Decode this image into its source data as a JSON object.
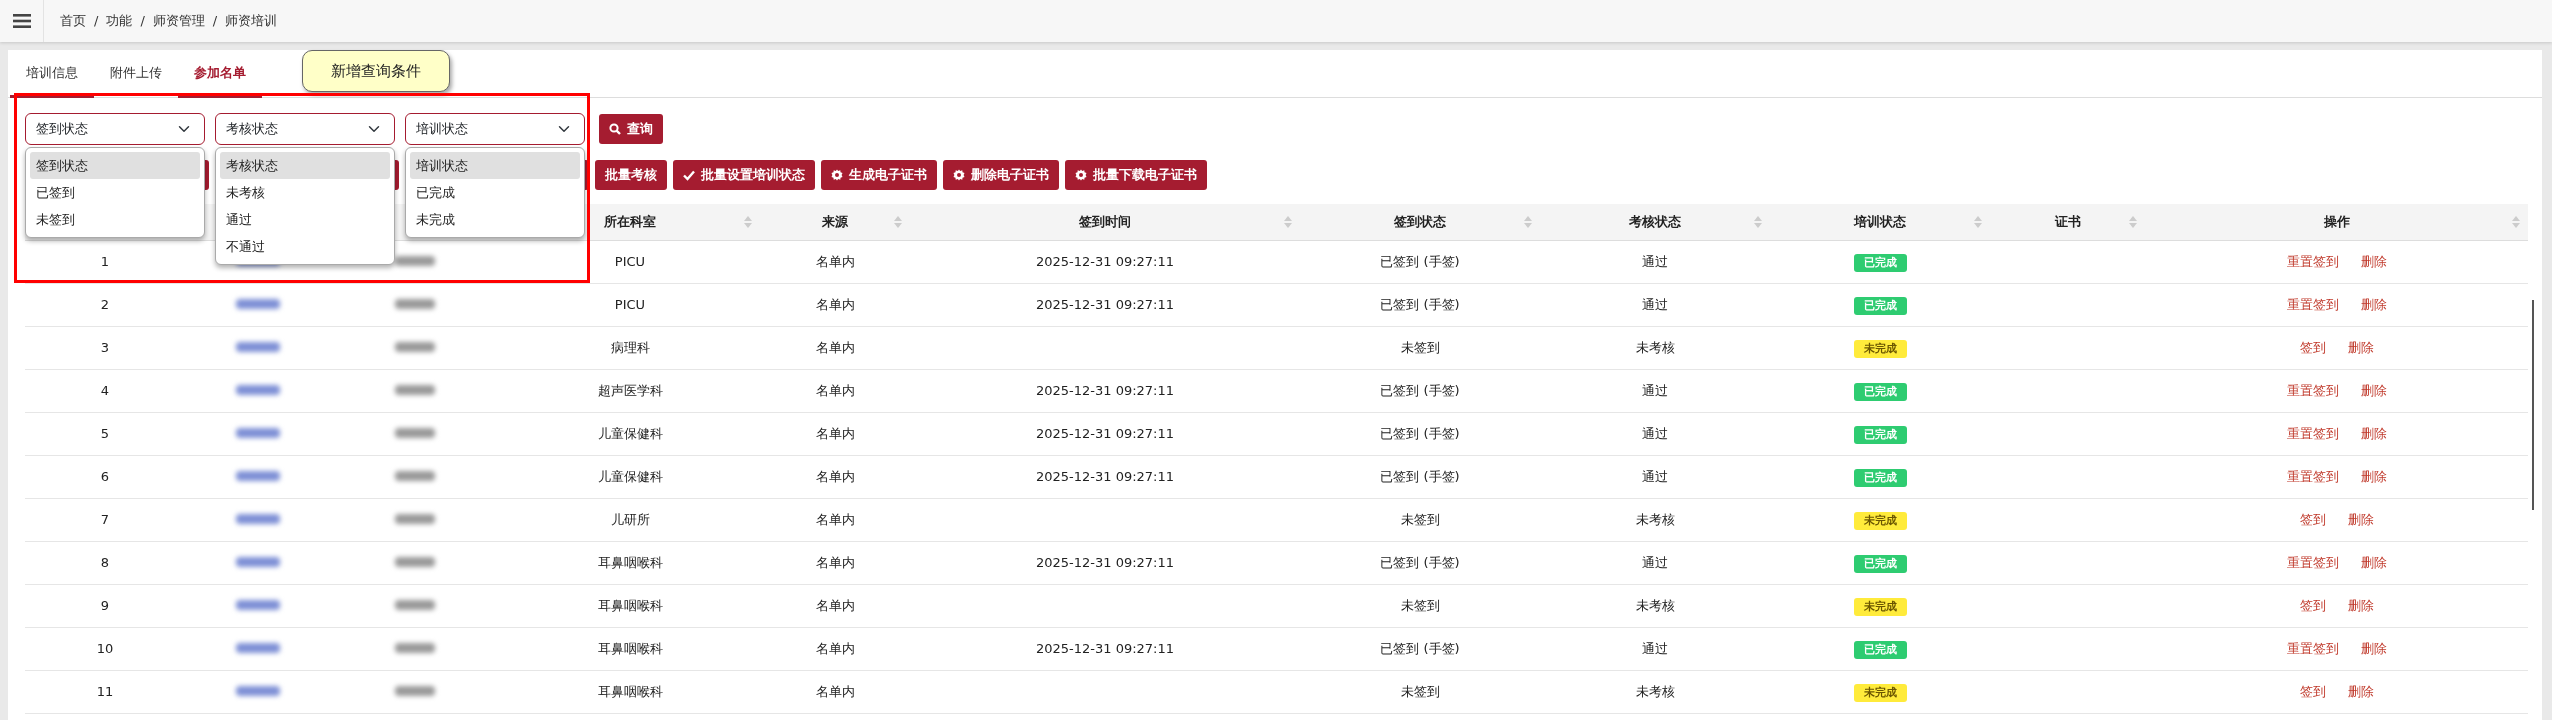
{
  "breadcrumb": [
    {
      "kind": "item",
      "text": "首页"
    },
    {
      "kind": "separator",
      "text": "/"
    },
    {
      "kind": "item",
      "text": "功能"
    },
    {
      "kind": "separator",
      "text": "/"
    },
    {
      "kind": "item",
      "text": "师资管理"
    },
    {
      "kind": "separator",
      "text": "/"
    },
    {
      "kind": "item",
      "text": "师资培训"
    }
  ],
  "tabs": [
    {
      "label": "培训信息",
      "selected": false,
      "underlined": true
    },
    {
      "label": "附件上传",
      "selected": false,
      "underlined": false
    },
    {
      "label": "参加名单",
      "selected": true,
      "underlined": true
    }
  ],
  "callout": "新增查询条件",
  "filters": [
    {
      "value": "签到状态",
      "options": [
        {
          "label": "签到状态",
          "selected": true
        },
        {
          "label": "已签到",
          "selected": false
        },
        {
          "label": "未签到",
          "selected": false
        }
      ]
    },
    {
      "value": "考核状态",
      "options": [
        {
          "label": "考核状态",
          "selected": true
        },
        {
          "label": "未考核",
          "selected": false
        },
        {
          "label": "通过",
          "selected": false
        },
        {
          "label": "不通过",
          "selected": false
        }
      ]
    },
    {
      "value": "培训状态",
      "options": [
        {
          "label": "培训状态",
          "selected": true
        },
        {
          "label": "已完成",
          "selected": false
        },
        {
          "label": "未完成",
          "selected": false
        }
      ]
    }
  ],
  "query_button": "查询",
  "toolbar": [
    {
      "kind": "covered"
    },
    {
      "kind": "covered"
    },
    {
      "kind": "covered"
    },
    {
      "kind": "plain",
      "label": "批量考核"
    },
    {
      "kind": "check",
      "label": "批量设置培训状态"
    },
    {
      "kind": "gear",
      "label": "生成电子证书"
    },
    {
      "kind": "gear",
      "label": "删除电子证书"
    },
    {
      "kind": "gear",
      "label": "批量下载电子证书"
    }
  ],
  "table": {
    "columns": [
      "",
      "",
      "",
      "所在科室",
      "来源",
      "签到时间",
      "签到状态",
      "考核状态",
      "培训状态",
      "证书",
      "操作"
    ],
    "rows": [
      {
        "index": "1",
        "department": "PICU",
        "source": "名单内",
        "time": "2025-12-31 09:27:11",
        "signin": "已签到 (手签)",
        "exam": "通过",
        "training": {
          "text": "已完成",
          "kind": "done"
        },
        "actions": [
          "重置签到",
          "删除"
        ]
      },
      {
        "index": "2",
        "department": "PICU",
        "source": "名单内",
        "time": "2025-12-31 09:27:11",
        "signin": "已签到 (手签)",
        "exam": "通过",
        "training": {
          "text": "已完成",
          "kind": "done"
        },
        "actions": [
          "重置签到",
          "删除"
        ]
      },
      {
        "index": "3",
        "department": "病理科",
        "source": "名单内",
        "signin": "未签到",
        "exam": "未考核",
        "training": {
          "text": "未完成",
          "kind": "todo"
        },
        "actions": [
          "签到",
          "删除"
        ]
      },
      {
        "index": "4",
        "department": "超声医学科",
        "source": "名单内",
        "time": "2025-12-31 09:27:11",
        "signin": "已签到 (手签)",
        "exam": "通过",
        "training": {
          "text": "已完成",
          "kind": "done"
        },
        "actions": [
          "重置签到",
          "删除"
        ]
      },
      {
        "index": "5",
        "department": "儿童保健科",
        "source": "名单内",
        "time": "2025-12-31 09:27:11",
        "signin": "已签到 (手签)",
        "exam": "通过",
        "training": {
          "text": "已完成",
          "kind": "done"
        },
        "actions": [
          "重置签到",
          "删除"
        ]
      },
      {
        "index": "6",
        "department": "儿童保健科",
        "source": "名单内",
        "time": "2025-12-31 09:27:11",
        "signin": "已签到 (手签)",
        "exam": "通过",
        "training": {
          "text": "已完成",
          "kind": "done"
        },
        "actions": [
          "重置签到",
          "删除"
        ]
      },
      {
        "index": "7",
        "department": "儿研所",
        "source": "名单内",
        "signin": "未签到",
        "exam": "未考核",
        "training": {
          "text": "未完成",
          "kind": "todo"
        },
        "actions": [
          "签到",
          "删除"
        ]
      },
      {
        "index": "8",
        "department": "耳鼻咽喉科",
        "source": "名单内",
        "time": "2025-12-31 09:27:11",
        "signin": "已签到 (手签)",
        "exam": "通过",
        "training": {
          "text": "已完成",
          "kind": "done"
        },
        "actions": [
          "重置签到",
          "删除"
        ]
      },
      {
        "index": "9",
        "department": "耳鼻咽喉科",
        "source": "名单内",
        "signin": "未签到",
        "exam": "未考核",
        "training": {
          "text": "未完成",
          "kind": "todo"
        },
        "actions": [
          "签到",
          "删除"
        ]
      },
      {
        "index": "10",
        "department": "耳鼻咽喉科",
        "source": "名单内",
        "time": "2025-12-31 09:27:11",
        "signin": "已签到 (手签)",
        "exam": "通过",
        "training": {
          "text": "已完成",
          "kind": "done"
        },
        "actions": [
          "重置签到",
          "删除"
        ]
      },
      {
        "index": "11",
        "department": "耳鼻咽喉科",
        "source": "名单内",
        "signin": "未签到",
        "exam": "未考核",
        "training": {
          "text": "未完成",
          "kind": "todo"
        },
        "actions": [
          "签到",
          "删除"
        ]
      }
    ]
  }
}
